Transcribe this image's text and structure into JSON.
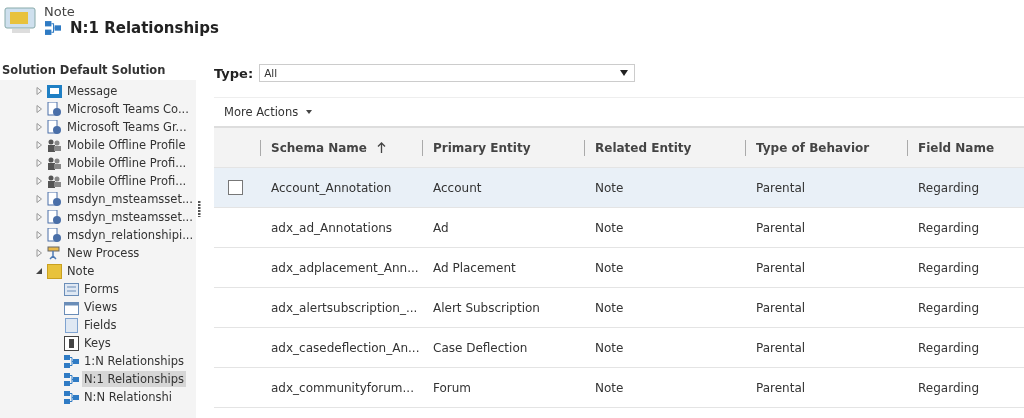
{
  "header": {
    "entity": "Note",
    "title": "N:1 Relationships"
  },
  "solution": {
    "label": "Solution",
    "name": "Default Solution"
  },
  "tree": [
    {
      "label": "Message",
      "kind": "message",
      "expanded": false,
      "selected": false
    },
    {
      "label": "Microsoft Teams Co...",
      "kind": "entity",
      "expanded": false,
      "selected": false
    },
    {
      "label": "Microsoft Teams Gr...",
      "kind": "entity",
      "expanded": false,
      "selected": false
    },
    {
      "label": "Mobile Offline Profile",
      "kind": "people",
      "expanded": false,
      "selected": false
    },
    {
      "label": "Mobile Offline Profi...",
      "kind": "people",
      "expanded": false,
      "selected": false
    },
    {
      "label": "Mobile Offline Profi...",
      "kind": "people",
      "expanded": false,
      "selected": false
    },
    {
      "label": "msdyn_msteamsset...",
      "kind": "entity",
      "expanded": false,
      "selected": false
    },
    {
      "label": "msdyn_msteamsset...",
      "kind": "entity",
      "expanded": false,
      "selected": false
    },
    {
      "label": "msdyn_relationshipi...",
      "kind": "entity",
      "expanded": false,
      "selected": false
    },
    {
      "label": "New Process",
      "kind": "process",
      "expanded": false,
      "selected": false
    },
    {
      "label": "Note",
      "kind": "note",
      "expanded": true,
      "selected": false,
      "children": [
        {
          "label": "Forms",
          "kind": "form",
          "selected": false
        },
        {
          "label": "Views",
          "kind": "view",
          "selected": false
        },
        {
          "label": "Fields",
          "kind": "field",
          "selected": false
        },
        {
          "label": "Keys",
          "kind": "key",
          "selected": false
        },
        {
          "label": "1:N Relationships",
          "kind": "relation",
          "selected": false
        },
        {
          "label": "N:1 Relationships",
          "kind": "relation",
          "selected": true
        },
        {
          "label": "N:N Relationshi",
          "kind": "relation",
          "selected": false
        }
      ]
    }
  ],
  "filter": {
    "label": "Type:",
    "value": "All"
  },
  "toolbar": {
    "more_actions": "More Actions"
  },
  "table": {
    "columns": [
      {
        "label": "Schema Name",
        "sorted": true
      },
      {
        "label": "Primary Entity",
        "sorted": false
      },
      {
        "label": "Related Entity",
        "sorted": false
      },
      {
        "label": "Type of Behavior",
        "sorted": false
      },
      {
        "label": "Field Name",
        "sorted": false
      }
    ],
    "rows": [
      {
        "selected": true,
        "cells": [
          "Account_Annotation",
          "Account",
          "Note",
          "Parental",
          "Regarding"
        ]
      },
      {
        "selected": false,
        "cells": [
          "adx_ad_Annotations",
          "Ad",
          "Note",
          "Parental",
          "Regarding"
        ]
      },
      {
        "selected": false,
        "cells": [
          "adx_adplacement_Ann...",
          "Ad Placement",
          "Note",
          "Parental",
          "Regarding"
        ]
      },
      {
        "selected": false,
        "cells": [
          "adx_alertsubscription_...",
          "Alert Subscription",
          "Note",
          "Parental",
          "Regarding"
        ]
      },
      {
        "selected": false,
        "cells": [
          "adx_casedeflection_An...",
          "Case Deflection",
          "Note",
          "Parental",
          "Regarding"
        ]
      },
      {
        "selected": false,
        "cells": [
          "adx_communityforum...",
          "Forum",
          "Note",
          "Parental",
          "Regarding"
        ]
      }
    ]
  }
}
